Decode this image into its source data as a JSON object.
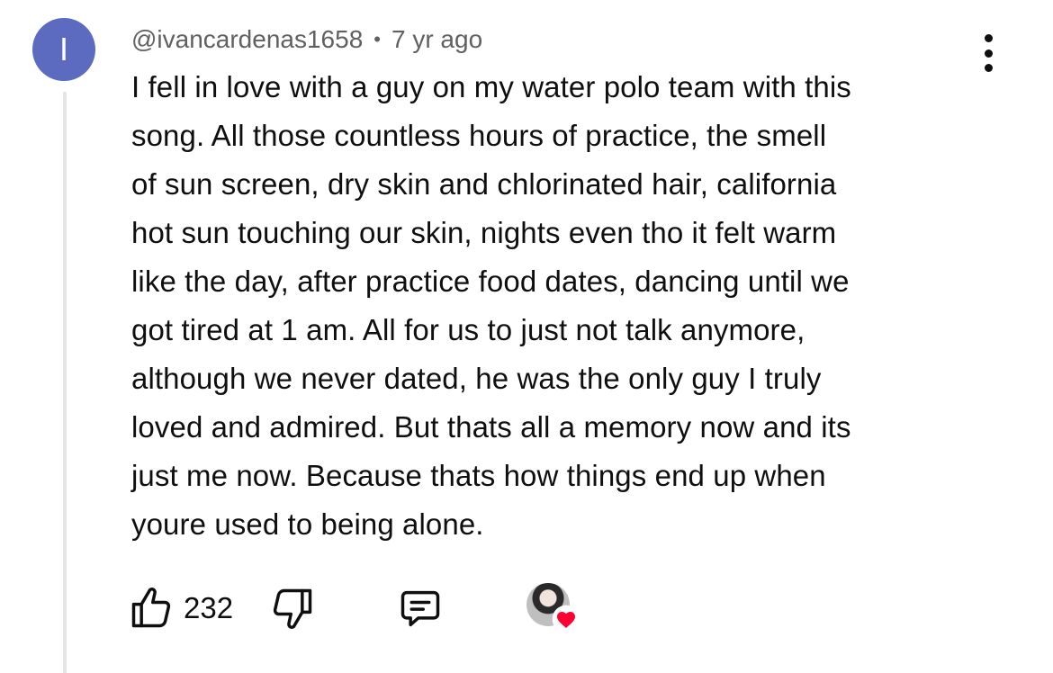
{
  "comment": {
    "avatar_letter": "I",
    "avatar_color": "#5c6bc0",
    "author": "@ivancardenas1658",
    "separator": "•",
    "time": "7 yr ago",
    "text_lines": [
      "I fell in love with a guy on my water polo team with this",
      "song. All those countless hours of practice, the smell",
      "of sun screen, dry skin and chlorinated hair, california",
      "hot sun touching our skin, nights even tho it felt warm",
      "like the day, after practice food dates, dancing until we",
      "got tired at 1 am. All for us to just not talk anymore,",
      "although we never dated, he was the only guy I truly",
      "loved and admired. But thats all a memory now and its",
      "just me now. Because thats how things end up when",
      "youre used to being alone."
    ]
  },
  "actions": {
    "like_count": "232",
    "icons": {
      "like": "thumb-up-icon",
      "dislike": "thumb-down-icon",
      "reply": "comment-icon",
      "more": "more-vertical-icon",
      "creator_heart": "creator-heart-icon"
    },
    "heart_color": "#ff0033"
  }
}
